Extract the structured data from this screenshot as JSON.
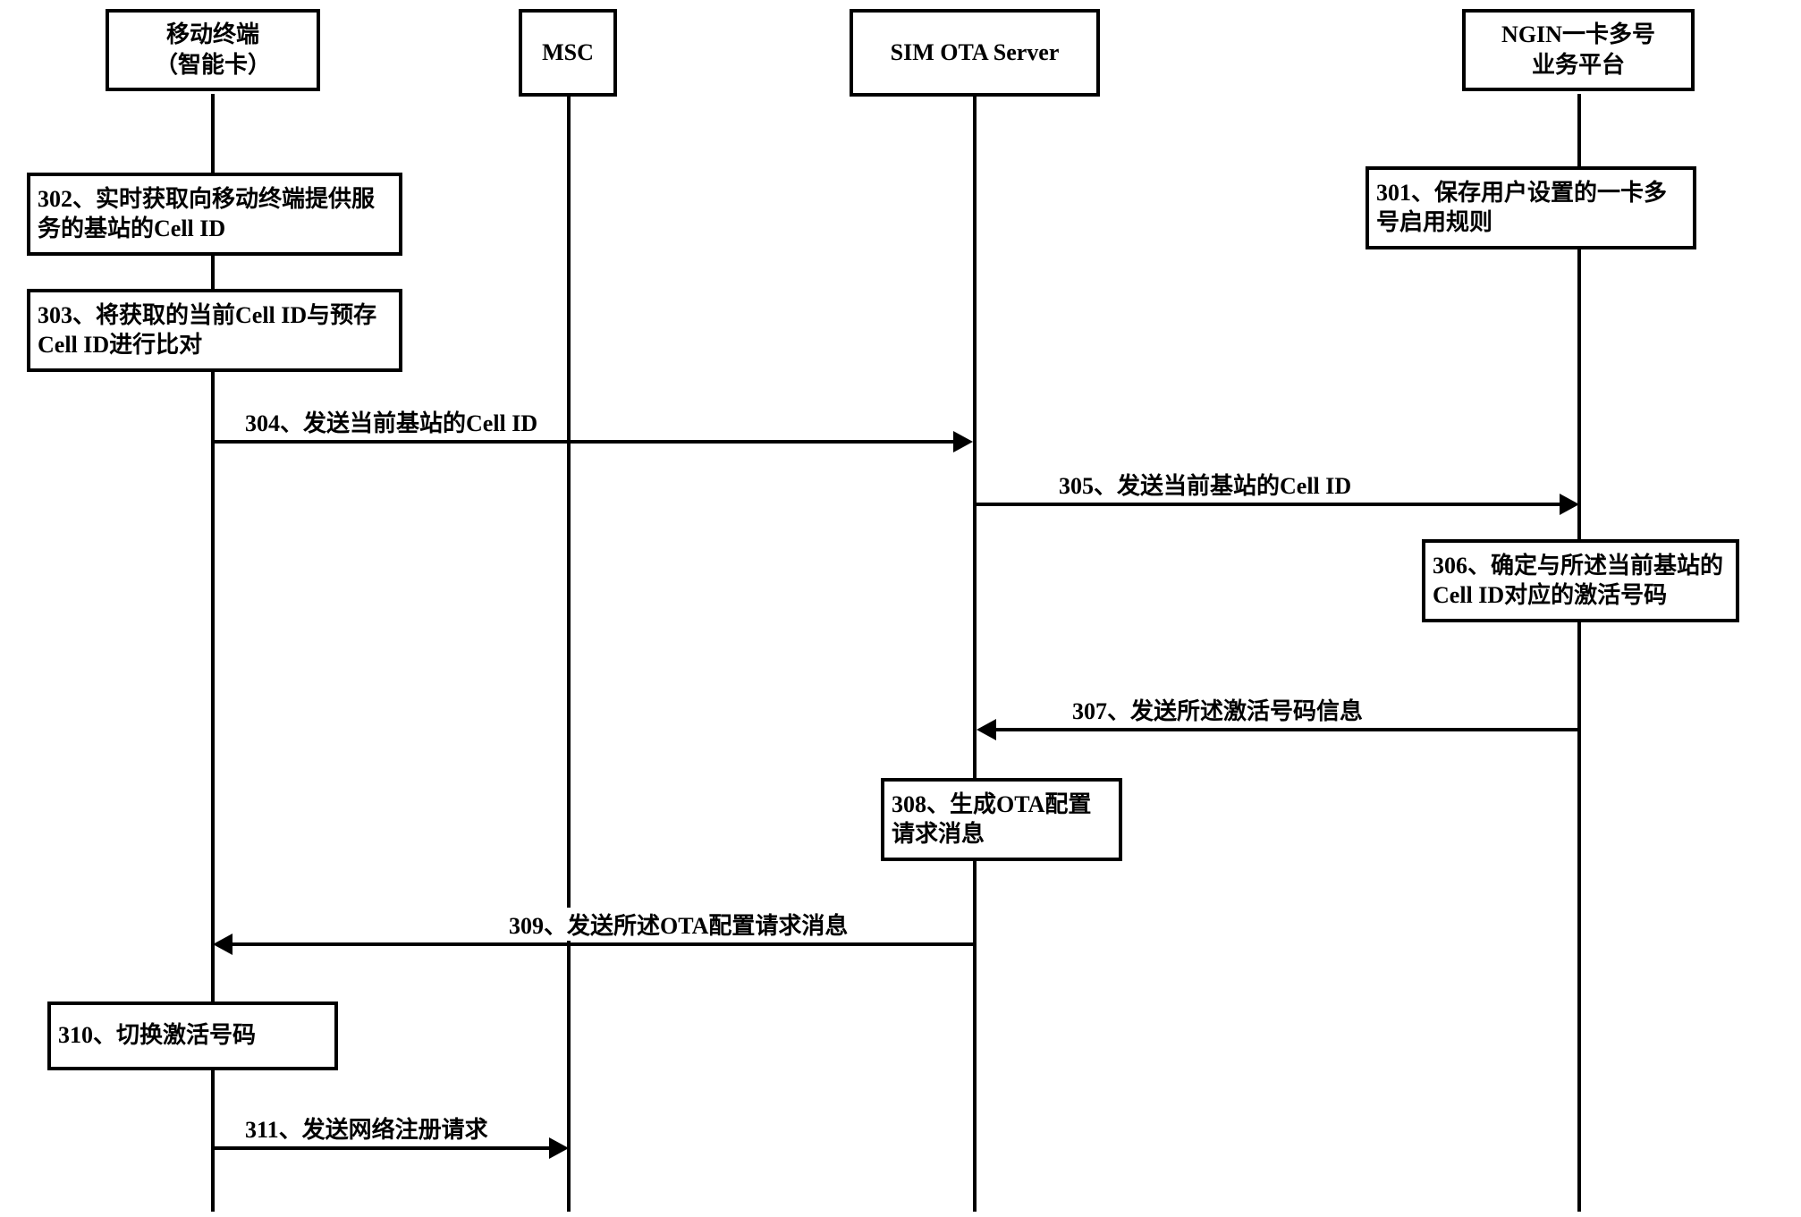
{
  "participants": {
    "p1": {
      "line1": "移动终端",
      "line2": "（智能卡）"
    },
    "p2": {
      "label": "MSC"
    },
    "p3": {
      "label": "SIM OTA Server"
    },
    "p4": {
      "line1": "NGIN一卡多号",
      "line2": "业务平台"
    }
  },
  "steps": {
    "s301": "301、保存用户设置的一卡多号启用规则",
    "s302": "302、实时获取向移动终端提供服务的基站的Cell ID",
    "s303": "303、将获取的当前Cell ID与预存Cell ID进行比对",
    "s306": "306、确定与所述当前基站的Cell ID对应的激活号码",
    "s308": "308、生成OTA配置请求消息",
    "s310": "310、切换激活号码"
  },
  "messages": {
    "m304": "304、发送当前基站的Cell ID",
    "m305": "305、发送当前基站的Cell ID",
    "m307": "307、发送所述激活号码信息",
    "m309": "309、发送所述OTA配置请求消息",
    "m311": "311、发送网络注册请求"
  }
}
